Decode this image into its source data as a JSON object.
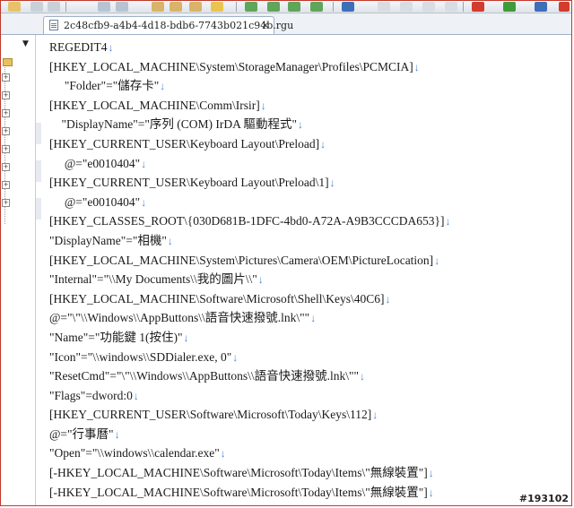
{
  "tab": {
    "filename": "2c48cfb9-a4b4-4d18-bdb6-7743b021c94b.rgu",
    "close_glyph": "×"
  },
  "editor": {
    "eol_glyph": "↓",
    "lines": [
      "REGEDIT4",
      "[HKEY_LOCAL_MACHINE\\System\\StorageManager\\Profiles\\PCMCIA]",
      "     \"Folder\"=\"儲存卡\"",
      "[HKEY_LOCAL_MACHINE\\Comm\\Irsir]",
      "    \"DisplayName\"=\"序列 (COM) IrDA 驅動程式\"",
      "[HKEY_CURRENT_USER\\Keyboard Layout\\Preload]",
      "     @=\"e0010404\"",
      "[HKEY_CURRENT_USER\\Keyboard Layout\\Preload\\1]",
      "     @=\"e0010404\"",
      "[HKEY_CLASSES_ROOT\\{030D681B-1DFC-4bd0-A72A-A9B3CCCDA653}]",
      "\"DisplayName\"=\"相機\"",
      "[HKEY_LOCAL_MACHINE\\System\\Pictures\\Camera\\OEM\\PictureLocation]",
      "\"Internal\"=\"\\\\My Documents\\\\我的圖片\\\\\"",
      "[HKEY_LOCAL_MACHINE\\Software\\Microsoft\\Shell\\Keys\\40C6]",
      "@=\"\\\"\\\\Windows\\\\AppButtons\\\\語音快速撥號.lnk\\\"\"",
      "\"Name\"=\"功能鍵 1(按住)\"",
      "\"Icon\"=\"\\\\windows\\\\SDDialer.exe, 0\"",
      "\"ResetCmd\"=\"\\\"\\\\Windows\\\\AppButtons\\\\語音快速撥號.lnk\\\"\"",
      "\"Flags\"=dword:0",
      "[HKEY_CURRENT_USER\\Software\\Microsoft\\Today\\Keys\\112]",
      "@=\"行事曆\"",
      "\"Open\"=\"\\\\windows\\\\calendar.exe\"",
      "[-HKEY_LOCAL_MACHINE\\Software\\Microsoft\\Today\\Items\\\"無線裝置\"]",
      "[-HKEY_LOCAL_MACHINE\\Software\\Microsoft\\Today\\Items\\\"無線裝置\"]"
    ]
  },
  "watermark": "#193102"
}
